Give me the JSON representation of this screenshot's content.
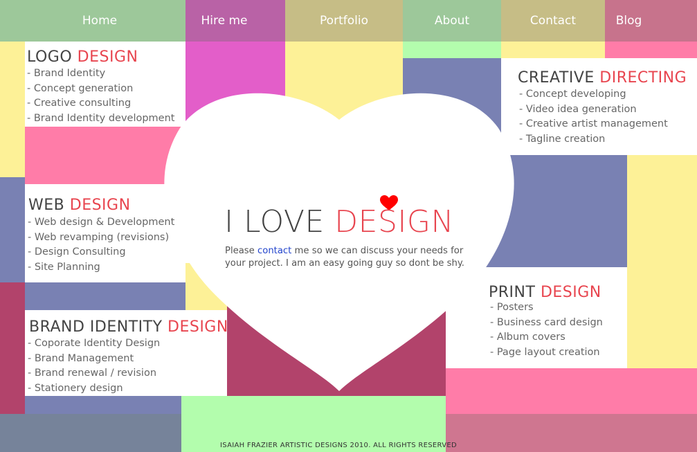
{
  "nav": {
    "items": [
      {
        "label": "Home",
        "color": "#9dc89a"
      },
      {
        "label": "Hire me",
        "color": "#b962a6"
      },
      {
        "label": "Portfolio",
        "color": "#c6bd86"
      },
      {
        "label": "About",
        "color": "#9dc89a"
      },
      {
        "label": "Contact",
        "color": "#c6bd86"
      },
      {
        "label": "Blog",
        "color": "#c7738c"
      }
    ]
  },
  "palette": {
    "yellow": "#fdf197",
    "pink": "#ff7ca8",
    "magenta": "#e35ec9",
    "slate": "#7981b3",
    "wine": "#b2436b",
    "mint": "#b3fdad",
    "accent": "#e8454f",
    "heart": "#ff0000"
  },
  "panels": {
    "logo": {
      "title_a": "LOGO ",
      "title_b": "DESIGN",
      "items": [
        "- Brand Identity",
        "- Concept generation",
        "- Creative consulting",
        "- Brand Identity development"
      ]
    },
    "web": {
      "title_a": "WEB ",
      "title_b": "DESIGN",
      "items": [
        "- Web design & Development",
        "- Web revamping (revisions)",
        "- Design Consulting",
        "- Site Planning"
      ]
    },
    "brand": {
      "title_a": "BRAND IDENTITY ",
      "title_b": "DESIGN",
      "items": [
        "- Coporate Identity Design",
        "- Brand Management",
        "- Brand renewal / revision",
        "- Stationery design"
      ]
    },
    "creative": {
      "title_a": "CREATIVE  ",
      "title_b": "DIRECTING",
      "items": [
        "- Concept developing",
        "- Video idea generation",
        "- Creative artist management",
        "- Tagline creation"
      ]
    },
    "print": {
      "title_a": "PRINT ",
      "title_b": "DESIGN",
      "items": [
        "- Posters",
        "- Business card design",
        "- Album covers",
        "- Page layout creation"
      ]
    }
  },
  "hero": {
    "title_a": "I LOVE ",
    "title_b": "DESIGN",
    "msg_before": "Please ",
    "msg_link": "contact",
    "msg_after": " me so we can discuss your needs for your project. I am an easy going guy so dont be shy."
  },
  "footer": {
    "text": "ISAIAH FRAZIER ARTISTIC DESIGNS 2010. ALL RIGHTS RESERVED"
  }
}
